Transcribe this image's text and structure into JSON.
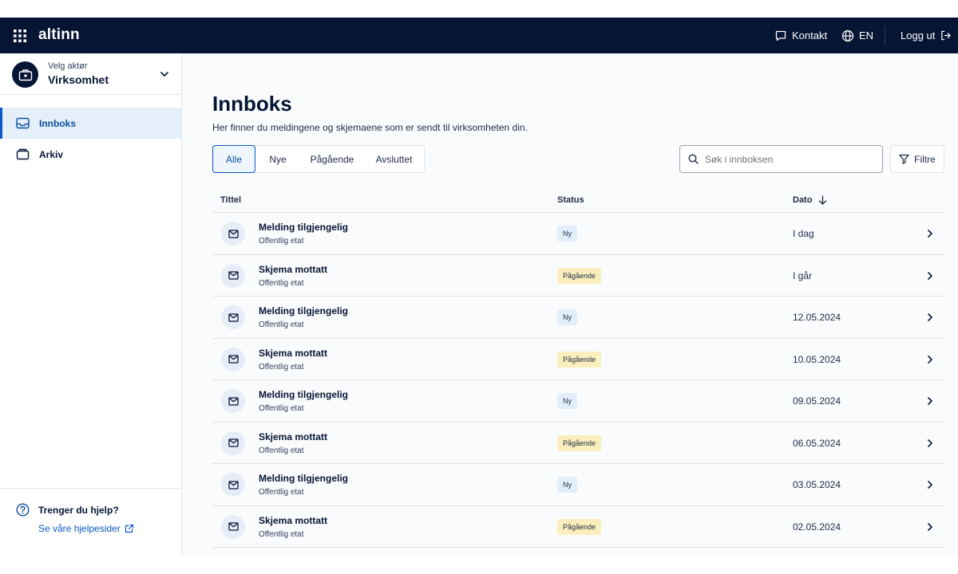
{
  "header": {
    "logo": "altinn",
    "contact_label": "Kontakt",
    "language_label": "EN",
    "logout_label": "Logg ut"
  },
  "sidebar": {
    "actor_label": "Velg aktør",
    "actor_name": "Virksomhet",
    "items": [
      {
        "label": "Innboks",
        "icon": "inbox-icon",
        "active": true
      },
      {
        "label": "Arkiv",
        "icon": "archive-icon",
        "active": false
      }
    ],
    "help_title": "Trenger du hjelp?",
    "help_link": "Se våre hjelpesider"
  },
  "main": {
    "title": "Innboks",
    "description": "Her finner du meldingene og skjemaene som er sendt til virksomheten din.",
    "tabs": [
      {
        "label": "Alle",
        "active": true
      },
      {
        "label": "Nye",
        "active": false
      },
      {
        "label": "Pågående",
        "active": false
      },
      {
        "label": "Avsluttet",
        "active": false
      }
    ],
    "search_placeholder": "Søk i innboksen",
    "filter_label": "Filtre",
    "columns": {
      "title": "Tittel",
      "status": "Status",
      "date": "Dato"
    },
    "rows": [
      {
        "title": "Melding tilgjengelig",
        "sender": "Offentlig etat",
        "status": "Ny",
        "status_type": "new",
        "date": "I dag"
      },
      {
        "title": "Skjema mottatt",
        "sender": "Offentlig etat",
        "status": "Pågående",
        "status_type": "progress",
        "date": "I går"
      },
      {
        "title": "Melding tilgjengelig",
        "sender": "Offentlig etat",
        "status": "Ny",
        "status_type": "new",
        "date": "12.05.2024"
      },
      {
        "title": "Skjema mottatt",
        "sender": "Offentlig etat",
        "status": "Pågående",
        "status_type": "progress",
        "date": "10.05.2024"
      },
      {
        "title": "Melding tilgjengelig",
        "sender": "Offentlig etat",
        "status": "Ny",
        "status_type": "new",
        "date": "09.05.2024"
      },
      {
        "title": "Skjema mottatt",
        "sender": "Offentlig etat",
        "status": "Pågående",
        "status_type": "progress",
        "date": "06.05.2024"
      },
      {
        "title": "Melding tilgjengelig",
        "sender": "Offentlig etat",
        "status": "Ny",
        "status_type": "new",
        "date": "03.05.2024"
      },
      {
        "title": "Skjema mottatt",
        "sender": "Offentlig etat",
        "status": "Pågående",
        "status_type": "progress",
        "date": "02.05.2024"
      }
    ]
  },
  "colors": {
    "header_bg": "#071535",
    "accent": "#0a59c4",
    "badge_new": "#e3eefb",
    "badge_progress": "#fbeebd"
  }
}
